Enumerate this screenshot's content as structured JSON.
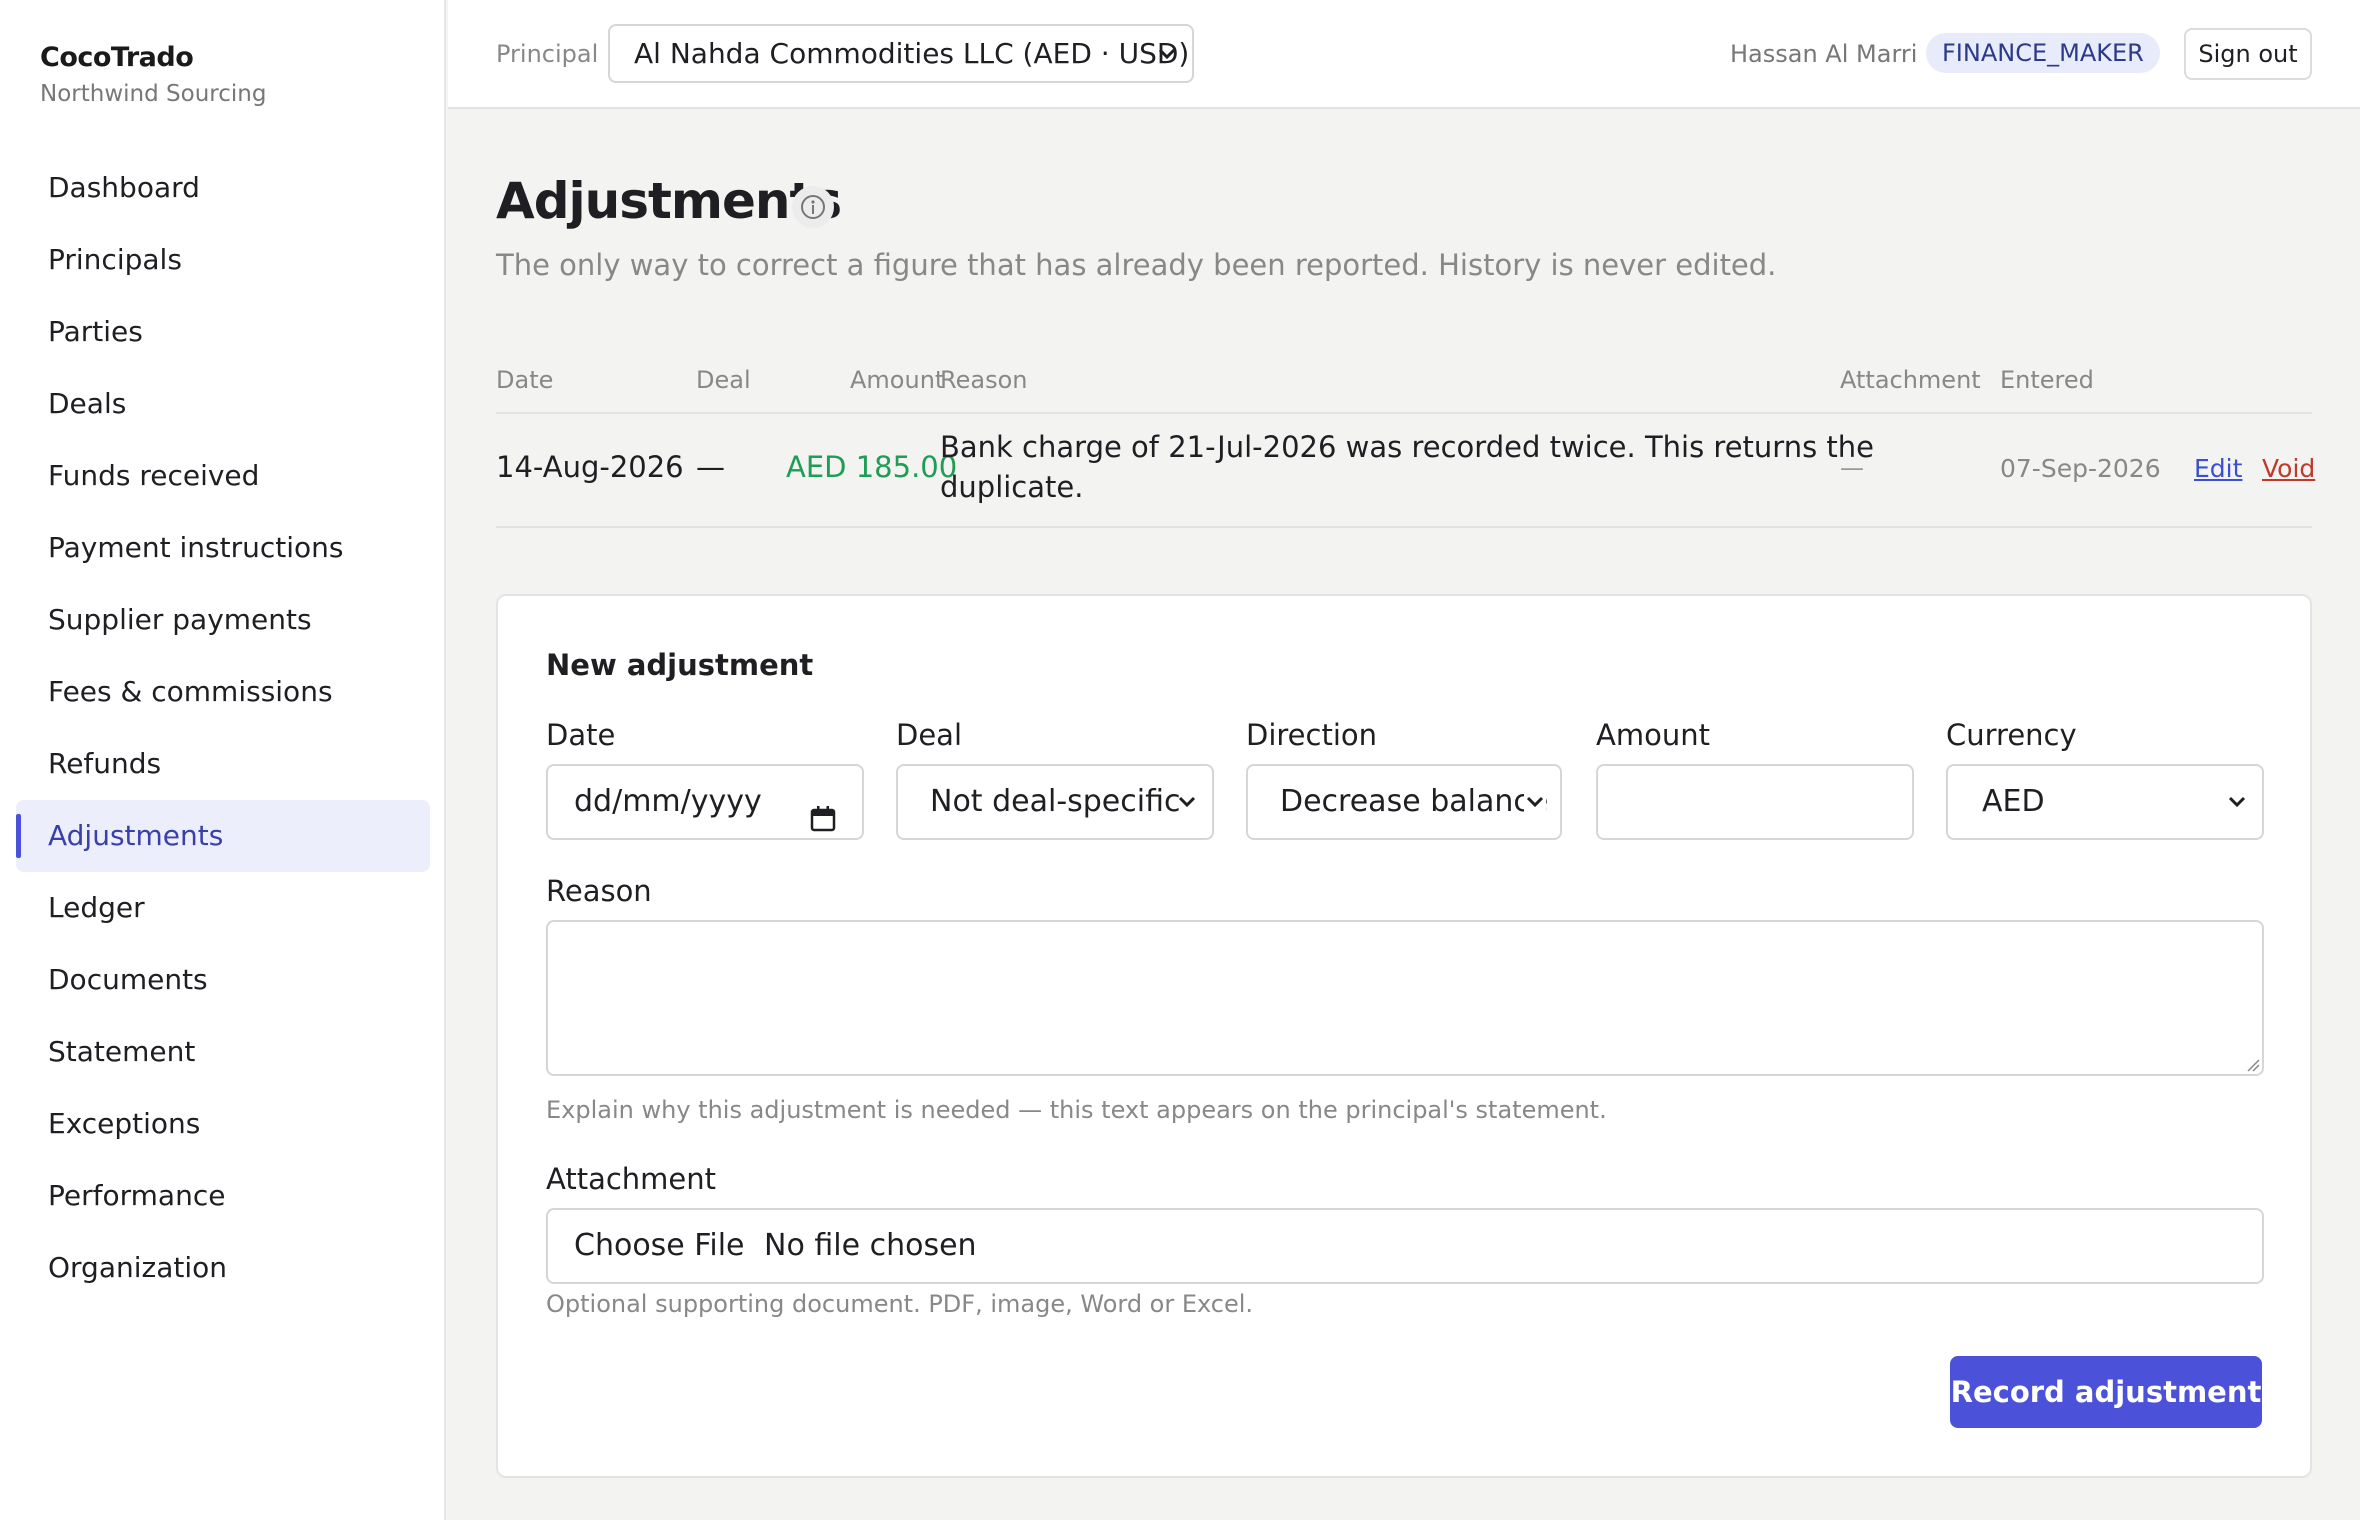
{
  "brand": {
    "name": "CocoTrado",
    "org": "Northwind Sourcing"
  },
  "nav": [
    {
      "label": "Dashboard"
    },
    {
      "label": "Principals"
    },
    {
      "label": "Parties"
    },
    {
      "label": "Deals"
    },
    {
      "label": "Funds received"
    },
    {
      "label": "Payment instructions"
    },
    {
      "label": "Supplier payments"
    },
    {
      "label": "Fees & commissions"
    },
    {
      "label": "Refunds"
    },
    {
      "label": "Adjustments",
      "active": true
    },
    {
      "label": "Ledger"
    },
    {
      "label": "Documents"
    },
    {
      "label": "Statement"
    },
    {
      "label": "Exceptions"
    },
    {
      "label": "Performance"
    },
    {
      "label": "Organization"
    }
  ],
  "topbar": {
    "principal_label": "Principal",
    "principal_value": "Al Nahda Commodities LLC (AED · USD)",
    "user_name": "Hassan Al Marri",
    "role": "FINANCE_MAKER",
    "sign_out": "Sign out"
  },
  "page": {
    "title": "Adjustments",
    "subtitle": "The only way to correct a figure that has already been reported. History is never edited."
  },
  "table": {
    "headers": {
      "date": "Date",
      "deal": "Deal",
      "amount": "Amount",
      "reason": "Reason",
      "attachment": "Attachment",
      "entered": "Entered"
    },
    "rows": [
      {
        "date": "14-Aug-2026",
        "deal": "—",
        "amount": "AED 185.00",
        "reason_line1": "Bank charge of 21-Jul-2026 was recorded twice. This returns the",
        "reason_line2": "duplicate.",
        "attachment": "—",
        "entered": "07-Sep-2026",
        "edit": "Edit",
        "void": "Void"
      }
    ]
  },
  "form": {
    "title": "New adjustment",
    "date_label": "Date",
    "date_placeholder": "dd/mm/yyyy",
    "deal_label": "Deal",
    "deal_value": "Not deal-specific",
    "direction_label": "Direction",
    "direction_value": "Decrease balance",
    "amount_label": "Amount",
    "amount_value": "",
    "currency_label": "Currency",
    "currency_value": "AED",
    "reason_label": "Reason",
    "reason_value": "",
    "reason_hint": "Explain why this adjustment is needed — this text appears on the principal's statement.",
    "attachment_label": "Attachment",
    "choose_file": "Choose File",
    "no_file": "No file chosen",
    "attachment_hint": "Optional supporting document. PDF, image, Word or Excel.",
    "submit": "Record adjustment"
  },
  "colors": {
    "accent": "#4b52d9",
    "amount_green": "#1f9d55",
    "void_red": "#c0392b",
    "edit_blue": "#3b4fd0",
    "role_bg": "#e7ebfa"
  }
}
